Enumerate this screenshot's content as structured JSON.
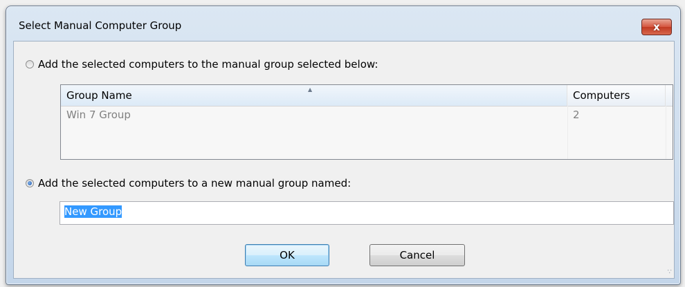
{
  "window": {
    "title": "Select Manual Computer Group",
    "close_label": "x"
  },
  "option_existing": {
    "label": "Add the selected computers to the manual group selected below:",
    "selected": false
  },
  "group_table": {
    "columns": [
      "Group Name",
      "Computers"
    ],
    "rows": [
      {
        "name": "Win 7 Group",
        "computers": "2"
      }
    ]
  },
  "option_new": {
    "label": "Add the selected computers to a new manual group named:",
    "selected": true
  },
  "new_group_input": {
    "value": "New Group"
  },
  "buttons": {
    "ok": "OK",
    "cancel": "Cancel"
  }
}
